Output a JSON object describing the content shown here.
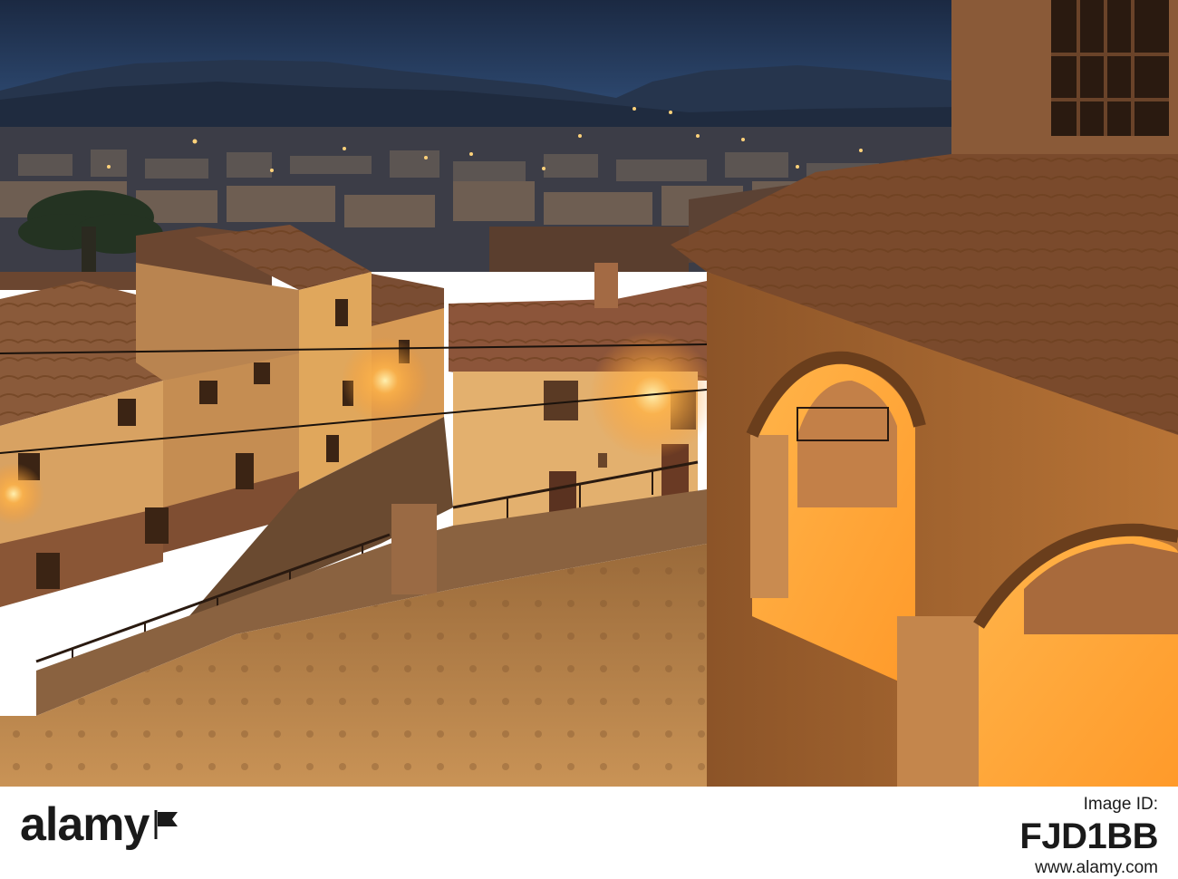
{
  "photo": {
    "subject": "night-town-view"
  },
  "footer": {
    "brand": "alamy",
    "image_id_label": "Image ID:",
    "image_id": "FJD1BB",
    "site": "www.alamy.com"
  },
  "watermark": {
    "text": "alamy"
  },
  "colors": {
    "sky_top": "#1d2b44",
    "sky_bottom": "#3a5a86",
    "lamp_glow": "#ffb04a",
    "footer_bg": "#ffffff"
  }
}
